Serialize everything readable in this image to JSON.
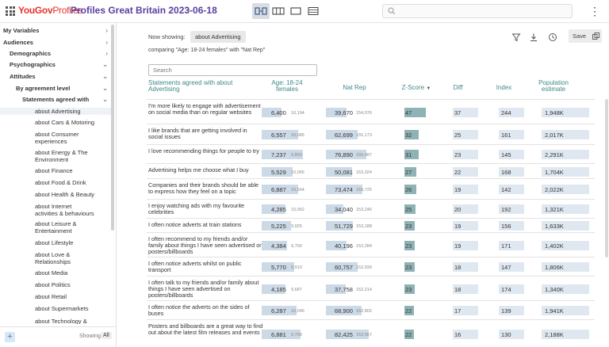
{
  "header": {
    "logo_you": "YouGov",
    "logo_profiles": "Profiles",
    "title": "Profiles Great Britain 2023-06-18",
    "search_placeholder": ""
  },
  "sidebar": {
    "items": [
      {
        "label": "My Variables",
        "level": 0,
        "chev": "›"
      },
      {
        "label": "Audiences",
        "level": 0,
        "chev": "›"
      },
      {
        "label": "Demographics",
        "level": 1,
        "chev": "›"
      },
      {
        "label": "Psychographics",
        "level": 1,
        "chev": "⌄"
      },
      {
        "label": "Attitudes",
        "level": 2,
        "chev": "⌄"
      },
      {
        "label": "By agreement level",
        "level": 3,
        "chev": "⌄"
      },
      {
        "label": "Statements agreed with",
        "level": 4,
        "chev": "⌄"
      },
      {
        "label": "about Advertising",
        "level": 5,
        "chev": ""
      },
      {
        "label": "about Cars & Motoring",
        "level": 5,
        "chev": ""
      },
      {
        "label": "about Consumer experiences",
        "level": 5,
        "chev": ""
      },
      {
        "label": "about Energy & The Environment",
        "level": 5,
        "chev": ""
      },
      {
        "label": "about Finance",
        "level": 5,
        "chev": ""
      },
      {
        "label": "about Food & Drink",
        "level": 5,
        "chev": ""
      },
      {
        "label": "about Health & Beauty",
        "level": 5,
        "chev": ""
      },
      {
        "label": "about Internet activities & behaviours",
        "level": 5,
        "chev": ""
      },
      {
        "label": "about Leisure & Entertainment",
        "level": 5,
        "chev": ""
      },
      {
        "label": "about Lifestyle",
        "level": 5,
        "chev": ""
      },
      {
        "label": "about Love & Relationships",
        "level": 5,
        "chev": ""
      },
      {
        "label": "about Media",
        "level": 5,
        "chev": ""
      },
      {
        "label": "about Politics",
        "level": 5,
        "chev": ""
      },
      {
        "label": "about Retail",
        "level": 5,
        "chev": ""
      },
      {
        "label": "about Supermarkets",
        "level": 5,
        "chev": ""
      },
      {
        "label": "about Technology &",
        "level": 5,
        "chev": ""
      }
    ],
    "add_label": "+",
    "showing_label": "Showing",
    "showing_value": "All"
  },
  "main": {
    "now_showing_label": "Now showing:",
    "now_showing_value": "about Advertising",
    "comparing": "comparing \"Age: 18-24 females\" with \"Nat Rep\"",
    "save_label": "Save",
    "table_search_placeholder": "Search",
    "columns": {
      "statement": "Statements agreed with about Advertising",
      "audience": "Age: 18-24 females",
      "natrep": "Nat Rep",
      "zscore": "Z-Score",
      "diff": "Diff",
      "index": "Index",
      "population": "Population estimate"
    },
    "rows": [
      {
        "statement": "I'm more likely to engage with advertisement on social media than on regular websites",
        "aud": "6,400",
        "aud_n": "10,194",
        "aud_pct": 0.36,
        "nat": "39,670",
        "nat_n": "154,076",
        "nat_pct": 0.26,
        "z": "47",
        "diff": "37",
        "index": "244",
        "pop": "1,948K"
      },
      {
        "statement": "I like brands that are getting involved in social issues",
        "aud": "6,557",
        "aud_n": "10,085",
        "aud_pct": 0.65,
        "nat": "62,699",
        "nat_n": "155,173",
        "nat_pct": 0.4,
        "z": "32",
        "diff": "25",
        "index": "161",
        "pop": "2,017K"
      },
      {
        "statement": "I love recommending things for people to try",
        "aud": "7,237",
        "aud_n": "9,800",
        "aud_pct": 0.74,
        "nat": "76,890",
        "nat_n": "150,487",
        "nat_pct": 0.51,
        "z": "31",
        "diff": "23",
        "index": "145",
        "pop": "2,291K"
      },
      {
        "statement": "Advertising helps me choose what I buy",
        "aud": "5,529",
        "aud_n": "10,065",
        "aud_pct": 0.55,
        "nat": "50,081",
        "nat_n": "153,324",
        "nat_pct": 0.33,
        "z": "27",
        "diff": "22",
        "index": "168",
        "pop": "1,704K"
      },
      {
        "statement": "Companies and their brands should be able to express how they feel on a topic",
        "aud": "6,887",
        "aud_n": "10,564",
        "aud_pct": 0.65,
        "nat": "73,474",
        "nat_n": "159,725",
        "nat_pct": 0.46,
        "z": "26",
        "diff": "19",
        "index": "142",
        "pop": "2,022K"
      },
      {
        "statement": "I enjoy watching ads with my favourite celebrities",
        "aud": "4,285",
        "aud_n": "10,062",
        "aud_pct": 0.43,
        "nat": "34,040",
        "nat_n": "153,246",
        "nat_pct": 0.22,
        "z": "25",
        "diff": "20",
        "index": "192",
        "pop": "1,321K"
      },
      {
        "statement": "I often notice adverts at train stations",
        "aud": "5,225",
        "aud_n": "9,925",
        "aud_pct": 0.53,
        "nat": "51,729",
        "nat_n": "153,188",
        "nat_pct": 0.34,
        "z": "23",
        "diff": "19",
        "index": "156",
        "pop": "1,633K"
      },
      {
        "statement": "I often recommend to my friends and/or family about things I have seen advertised on posters/billboards",
        "aud": "4,384",
        "aud_n": "9,700",
        "aud_pct": 0.45,
        "nat": "40,196",
        "nat_n": "152,284",
        "nat_pct": 0.26,
        "z": "23",
        "diff": "19",
        "index": "171",
        "pop": "1,402K"
      },
      {
        "statement": "I often notice adverts whilst on public transport",
        "aud": "5,770",
        "aud_n": "9,910",
        "aud_pct": 0.58,
        "nat": "60,757",
        "nat_n": "152,939",
        "nat_pct": 0.4,
        "z": "23",
        "diff": "18",
        "index": "147",
        "pop": "1,806K"
      },
      {
        "statement": "I often talk to my friends and/or family about things I have seen advertised on posters/billboards",
        "aud": "4,185",
        "aud_n": "9,687",
        "aud_pct": 0.43,
        "nat": "37,758",
        "nat_n": "152,214",
        "nat_pct": 0.25,
        "z": "23",
        "diff": "18",
        "index": "174",
        "pop": "1,340K"
      },
      {
        "statement": "I often notice the adverts on the sides of buses",
        "aud": "6,287",
        "aud_n": "10,046",
        "aud_pct": 0.63,
        "nat": "68,900",
        "nat_n": "152,802",
        "nat_pct": 0.45,
        "z": "22",
        "diff": "17",
        "index": "139",
        "pop": "1,941K"
      },
      {
        "statement": "Posters and billboards are a great way to find out about the latest film releases and events",
        "aud": "6,881",
        "aud_n": "9,758",
        "aud_pct": 0.7,
        "nat": "82,425",
        "nat_n": "152,067",
        "nat_pct": 0.54,
        "z": "22",
        "diff": "16",
        "index": "130",
        "pop": "2,188K"
      }
    ]
  },
  "icons": {
    "apps": "grid-icon",
    "filter": "filter-icon",
    "download": "download-icon",
    "history": "clock-icon",
    "copy": "copy-icon"
  },
  "colors": {
    "brand_red": "#e6332a",
    "title_purple": "#5a3fa0",
    "header_teal": "#3e8a86",
    "bar_blue": "#ccd9e6",
    "bar_teal": "#8fb3b5"
  }
}
